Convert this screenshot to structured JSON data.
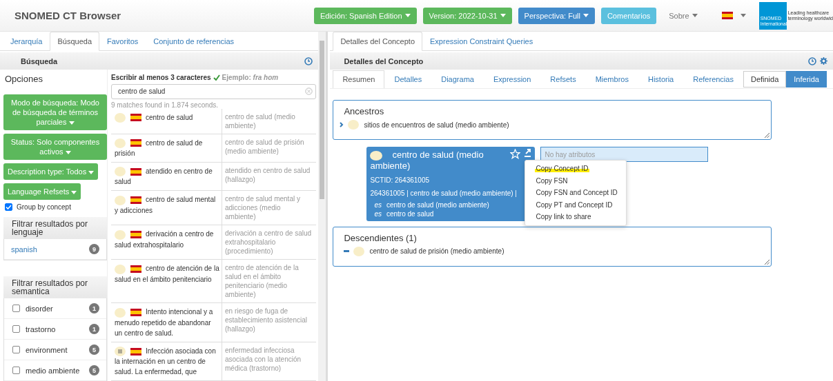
{
  "header": {
    "title": "SNOMED CT Browser",
    "buttons": [
      {
        "label": "Edición: Spanish Edition",
        "kind": "green",
        "caret": true
      },
      {
        "label": "Version: 2022-10-31",
        "kind": "green",
        "caret": true
      },
      {
        "label": "Perspectiva: Full",
        "kind": "blue",
        "caret": true
      },
      {
        "label": "Comentarios",
        "kind": "cyan",
        "caret": false
      },
      {
        "label": "Sobre",
        "kind": "plain",
        "caret": true
      }
    ],
    "logo": {
      "name": "SNOMED",
      "sub": "International",
      "tagline_1": "Leading healthcare",
      "tagline_2": "terminology worldwid"
    }
  },
  "left": {
    "tabs": [
      {
        "label": "Jerarquía",
        "selected": false
      },
      {
        "label": "Búsqueda",
        "selected": true
      },
      {
        "label": "Favoritos",
        "selected": false
      },
      {
        "label": "Conjunto de referencias",
        "selected": false
      }
    ],
    "panel_title": "Búsqueda",
    "options": {
      "heading": "Opciones",
      "dropdowns": [
        "Modo de búsqueda: Modo de búsqueda de términos parciales",
        "Status: Solo componentes activos",
        "Description type: Todos",
        "Language Refsets"
      ],
      "group_by_concept": {
        "label": "Group by concept",
        "checked": true
      },
      "language_filter": {
        "heading": "Filtrar resultados por lenguaje",
        "items": [
          {
            "label": "spanish",
            "count": "9"
          }
        ]
      },
      "semantic_filter": {
        "heading": "Filtrar resultados por semantica",
        "items": [
          {
            "label": "disorder",
            "count": "1",
            "checked": false
          },
          {
            "label": "trastorno",
            "count": "1",
            "checked": false
          },
          {
            "label": "environment",
            "count": "5",
            "checked": false
          },
          {
            "label": "medio ambiente",
            "count": "5",
            "checked": false
          }
        ]
      }
    },
    "search": {
      "hint": "Escribir al menos 3 caracteres",
      "example_label": "Ejemplo:",
      "example": "fra hom",
      "value": "centro de salud",
      "status": "9 matches found in 1.874 seconds.",
      "results": [
        {
          "term": "centro de salud",
          "fsn": "centro de salud (medio ambiente)",
          "defined": false
        },
        {
          "term": "centro de salud de prisión",
          "fsn": "centro de salud de prisión (medio ambiente)",
          "defined": false
        },
        {
          "term": "atendido en centro de salud",
          "fsn": "atendido en centro de salud (hallazgo)",
          "defined": false
        },
        {
          "term": "centro de salud mental y adicciones",
          "fsn": "centro de salud mental y adicciones (medio ambiente)",
          "defined": false
        },
        {
          "term": "derivación a centro de salud extrahospitalario",
          "fsn": "derivación a centro de salud extrahospitalario (procedimiento)",
          "defined": false
        },
        {
          "term": "centro de atención de la salud en el ámbito penitenciario",
          "fsn": "centro de atención de la salud en el ámbito penitenciario (medio ambiente)",
          "defined": false
        },
        {
          "term": "Intento intencional y a menudo repetido de abandonar un centro de salud.",
          "fsn": "en riesgo de fuga de establecimiento asistencial (hallazgo)",
          "defined": false
        },
        {
          "term": "Infección asociada con la internación en un centro de salud. La enfermedad, que",
          "fsn": "enfermedad infecciosa asociada con la atención médica (trastorno)",
          "defined": true
        }
      ]
    }
  },
  "right": {
    "tabs": [
      {
        "label": "Detalles del Concepto",
        "selected": true
      },
      {
        "label": "Expression Constraint Queries",
        "selected": false
      }
    ],
    "panel_title": "Detalles del Concepto",
    "subtabs": [
      {
        "label": "Resumen",
        "selected": true
      },
      {
        "label": "Detalles",
        "selected": false
      },
      {
        "label": "Diagrama",
        "selected": false
      },
      {
        "label": "Expression",
        "selected": false
      },
      {
        "label": "Refsets",
        "selected": false
      },
      {
        "label": "Miembros",
        "selected": false
      },
      {
        "label": "Historia",
        "selected": false
      },
      {
        "label": "Referencias",
        "selected": false
      }
    ],
    "view": [
      {
        "label": "Definida",
        "selected": false
      },
      {
        "label": "Inferida",
        "selected": true
      }
    ],
    "ancestors": {
      "heading": "Ancestros",
      "items": [
        {
          "label": "sitios de encuentros de salud (medio ambiente)"
        }
      ]
    },
    "concept": {
      "title": "centro de salud (medio ambiente)",
      "sctid": "SCTID: 264361005",
      "expression": "264361005 | centro de salud (medio ambiente) |",
      "descriptions": [
        {
          "lang": "es",
          "term": "centro de salud (medio ambiente)"
        },
        {
          "lang": "es",
          "term": "centro de salud"
        }
      ]
    },
    "attributes_placeholder": "No hay atributos",
    "menu": [
      {
        "label": "Copy Concept ID",
        "selected": true
      },
      {
        "label": "Copy FSN",
        "selected": false
      },
      {
        "label": "Copy FSN and Concept ID",
        "selected": false
      },
      {
        "label": "Copy PT and Concept ID",
        "selected": false
      },
      {
        "label": "Copy link to share",
        "selected": false
      }
    ],
    "descendants": {
      "heading": "Descendientes (1)",
      "items": [
        {
          "label": "centro de salud de prisión (medio ambiente)"
        }
      ]
    }
  }
}
